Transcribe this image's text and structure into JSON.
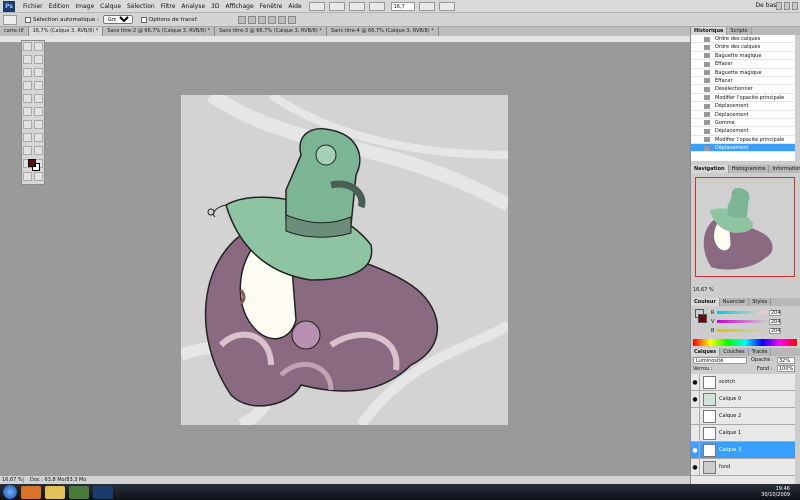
{
  "menu": {
    "logo": "Ps",
    "items": [
      "Fichier",
      "Edition",
      "Image",
      "Calque",
      "Sélection",
      "Filtre",
      "Analyse",
      "3D",
      "Affichage",
      "Fenêtre",
      "Aide"
    ],
    "zoom": "16,7",
    "workspace": "De base"
  },
  "options": {
    "auto_select_label": "Sélection automatique :",
    "auto_select_value": "Groupe",
    "transform_label": "Options de transf."
  },
  "tabs": [
    {
      "label": "carte.tif",
      "active": false
    },
    {
      "label": "16,7% (Calque 3, RVB/8) *",
      "active": true
    },
    {
      "label": "Sans titre-2 @ 66,7% (Calque 3, RVB/8) *",
      "active": false
    },
    {
      "label": "Sans titre-3 @ 66,7% (Calque 3, RVB/8) *",
      "active": false
    },
    {
      "label": "Sans titre-4 @ 66,7% (Calque 3, RVB/8) *",
      "active": false
    }
  ],
  "status": {
    "zoom": "16,67 %",
    "docinfo": "Doc : 63,8 Mo/83,3 Mo"
  },
  "history": {
    "tabs": [
      "Historique",
      "Scripts"
    ],
    "items": [
      "Ordre des calques",
      "Ordre des calques",
      "Baguette magique",
      "Effacer",
      "Baguette magique",
      "Effacer",
      "Désélectionner",
      "Modifier l'opacité principale",
      "Déplacement",
      "Déplacement",
      "Gomme",
      "Déplacement",
      "Modifier l'opacité principale",
      "Déplacement"
    ],
    "selected_index": 13
  },
  "navigator": {
    "tabs": [
      "Navigation",
      "Histogramme",
      "Informations"
    ],
    "zoom": "16,67 %"
  },
  "color": {
    "tabs": [
      "Couleur",
      "Nuancier",
      "Styles"
    ],
    "channels": [
      {
        "label": "R",
        "value": "204",
        "gradient": "linear-gradient(to right, #00cccc, #ffcccc)"
      },
      {
        "label": "V",
        "value": "204",
        "gradient": "linear-gradient(to right, #cc00cc, #cccccc)"
      },
      {
        "label": "B",
        "value": "204",
        "gradient": "linear-gradient(to right, #cccc00, #cccccc)"
      }
    ]
  },
  "layers": {
    "tabs": [
      "Calques",
      "Couches",
      "Tracés"
    ],
    "blend_mode": "Luminosité",
    "opacity_label": "Opacité :",
    "opacity": "32%",
    "lock_label": "Verrou :",
    "fill_label": "Fond :",
    "fill": "100%",
    "items": [
      {
        "name": "scotch",
        "visible": true,
        "selected": false
      },
      {
        "name": "Calque 0",
        "visible": true,
        "selected": false
      },
      {
        "name": "Calque 2",
        "visible": false,
        "selected": false
      },
      {
        "name": "Calque 1",
        "visible": false,
        "selected": false
      },
      {
        "name": "Calque 3",
        "visible": true,
        "selected": true
      },
      {
        "name": "fond",
        "visible": true,
        "selected": false
      }
    ]
  },
  "taskbar": {
    "time": "19:46",
    "date": "30/10/2009"
  }
}
